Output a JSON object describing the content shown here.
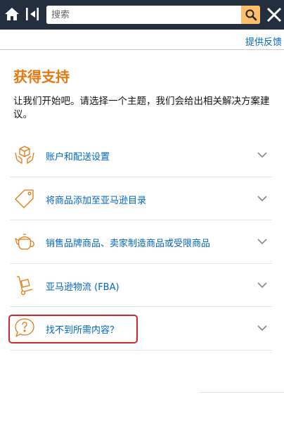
{
  "header": {
    "search_placeholder": "搜索",
    "colors": {
      "bar": "#232f3e",
      "search_button": "#febd69"
    }
  },
  "feedback_link": "提供反馈",
  "page": {
    "title": "获得支持",
    "intro": "让我们开始吧。请选择一个主题，我们会给出相关解决方案建议。"
  },
  "topics": [
    {
      "label": "账户和配送设置",
      "icon": "box-in-hands-icon"
    },
    {
      "label": "将商品添加至亚马逊目录",
      "icon": "price-tag-icon"
    },
    {
      "label": "销售品牌商品、卖家制造商品或受限商品",
      "icon": "teapot-icon"
    },
    {
      "label": "亚马逊物流 (FBA)",
      "icon": "hand-truck-icon"
    },
    {
      "label": "找不到所需内容？",
      "icon": "question-bubble-icon"
    }
  ],
  "colors": {
    "accent": "#e47911",
    "link": "#0066c0",
    "highlight_border": "#d0282a"
  }
}
